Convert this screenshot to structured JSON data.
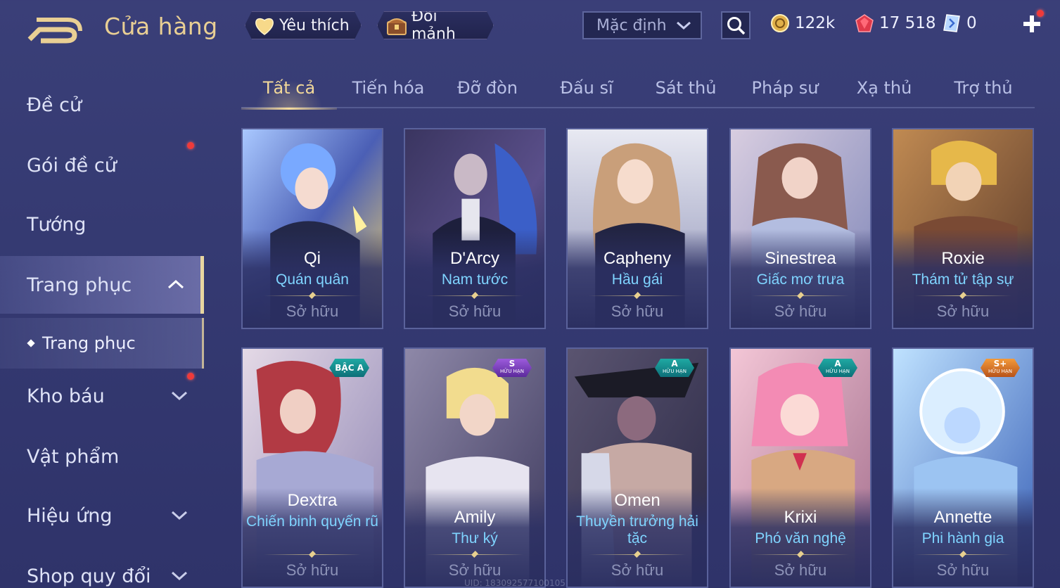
{
  "header": {
    "title": "Cửa hàng",
    "favorite_label": "Yêu thích",
    "exchange_label": "Đổi mảnh",
    "sort_value": "Mặc định"
  },
  "currencies": {
    "gold": "122k",
    "ruby": "17 518",
    "voucher": "0"
  },
  "sidebar": {
    "items": [
      {
        "label": "Đề cử"
      },
      {
        "label": "Gói đề cử"
      },
      {
        "label": "Tướng"
      },
      {
        "label": "Trang phục"
      },
      {
        "label": "Kho báu"
      },
      {
        "label": "Vật phẩm"
      },
      {
        "label": "Hiệu ứng"
      },
      {
        "label": "Shop quy đổi"
      }
    ],
    "sub_item": "Trang phục"
  },
  "tabs": [
    "Tất cả",
    "Tiến hóa",
    "Đỡ đòn",
    "Đấu sĩ",
    "Sát thủ",
    "Pháp sư",
    "Xạ thủ",
    "Trợ thủ"
  ],
  "cards": [
    {
      "hero": "Qi",
      "skin": "Quán quân",
      "status": "Sở hữu",
      "badge": ""
    },
    {
      "hero": "D'Arcy",
      "skin": "Nam tước",
      "status": "Sở hữu",
      "badge": ""
    },
    {
      "hero": "Capheny",
      "skin": "Hầu gái",
      "status": "Sở hữu",
      "badge": ""
    },
    {
      "hero": "Sinestrea",
      "skin": "Giấc mơ trưa",
      "status": "Sở hữu",
      "badge": ""
    },
    {
      "hero": "Roxie",
      "skin": "Thám tử tập sự",
      "status": "Sở hữu",
      "badge": ""
    },
    {
      "hero": "Dextra",
      "skin": "Chiến binh quyến rũ",
      "status": "Sở hữu",
      "badge": "BẬC A",
      "badge_sub": ""
    },
    {
      "hero": "Amily",
      "skin": "Thư ký",
      "status": "Sở hữu",
      "badge": "S",
      "badge_sub": "HỮU HẠN"
    },
    {
      "hero": "Omen",
      "skin": "Thuyền trưởng hải tặc",
      "status": "Sở hữu",
      "badge": "A",
      "badge_sub": "HỮU HẠN"
    },
    {
      "hero": "Krixi",
      "skin": "Phó văn nghệ",
      "status": "Sở hữu",
      "badge": "A",
      "badge_sub": "HỮU HẠN"
    },
    {
      "hero": "Annette",
      "skin": "Phi hành gia",
      "status": "Sở hữu",
      "badge": "S+",
      "badge_sub": "HỮU HẠN"
    }
  ],
  "footer": {
    "uid": "UID: 183092577100105"
  },
  "colors": {
    "accent_gold": "#f2d99a",
    "skin_name": "#7fd4ff",
    "notification": "#f03a3a"
  }
}
